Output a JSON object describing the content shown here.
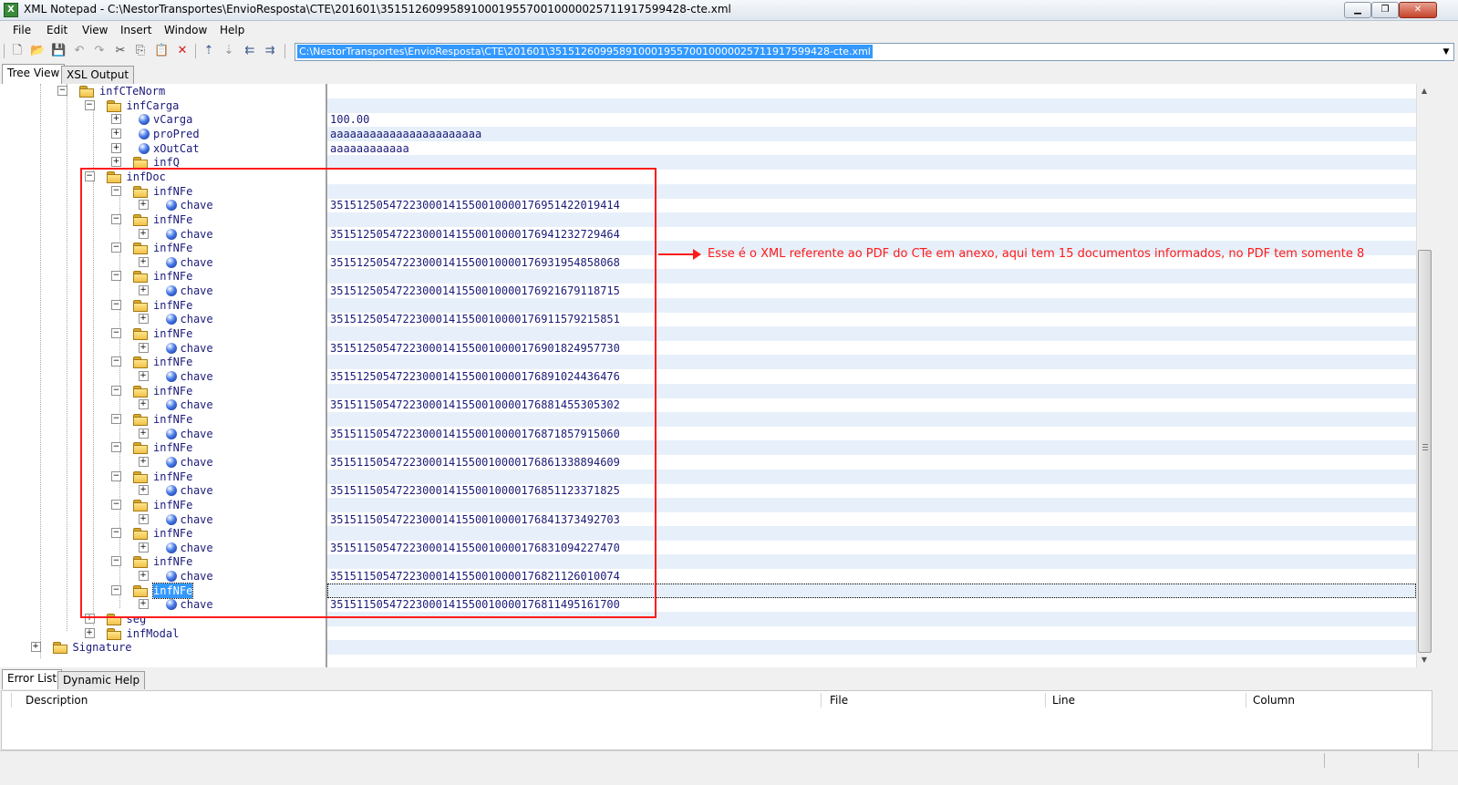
{
  "window": {
    "title": "XML Notepad - C:\\NestorTransportes\\EnvioResposta\\CTE\\201601\\35151260995891000195570010000025711917599428-cte.xml",
    "app_icon": "X"
  },
  "menu": [
    "File",
    "Edit",
    "View",
    "Insert",
    "Window",
    "Help"
  ],
  "toolbar": {
    "icons": [
      "new-icon",
      "open-icon",
      "save-icon",
      "undo-icon",
      "redo-icon",
      "cut-icon",
      "copy-icon",
      "paste-icon",
      "delete-icon",
      "nudge-up-icon",
      "nudge-down-icon",
      "nudge-left-icon",
      "nudge-right-icon"
    ],
    "path": "C:\\NestorTransportes\\EnvioResposta\\CTE\\201601\\35151260995891000195570010000025711917599428-cte.xml"
  },
  "tabs": [
    "Tree View",
    "XSL Output"
  ],
  "tree": [
    {
      "label": "infCTeNorm",
      "type": "element",
      "expander": "−"
    },
    {
      "label": "infCarga",
      "type": "element",
      "expander": "−"
    },
    {
      "label": "vCarga",
      "type": "attribute",
      "expander": "+",
      "value": "100.00"
    },
    {
      "label": "proPred",
      "type": "attribute",
      "expander": "+",
      "value": "aaaaaaaaaaaaaaaaaaaaaaa"
    },
    {
      "label": "xOutCat",
      "type": "attribute",
      "expander": "+",
      "value": "aaaaaaaaaaaa"
    },
    {
      "label": "infQ",
      "type": "element",
      "expander": "+"
    },
    {
      "label": "infDoc",
      "type": "element",
      "expander": "−"
    },
    {
      "label": "infNFe",
      "type": "element",
      "expander": "−"
    },
    {
      "label": "chave",
      "type": "attribute",
      "expander": "+",
      "value": "35151250547223000141550010000176951422019414"
    },
    {
      "label": "infNFe",
      "type": "element",
      "expander": "−"
    },
    {
      "label": "chave",
      "type": "attribute",
      "expander": "+",
      "value": "35151250547223000141550010000176941232729464"
    },
    {
      "label": "infNFe",
      "type": "element",
      "expander": "−"
    },
    {
      "label": "chave",
      "type": "attribute",
      "expander": "+",
      "value": "35151250547223000141550010000176931954858068"
    },
    {
      "label": "infNFe",
      "type": "element",
      "expander": "−"
    },
    {
      "label": "chave",
      "type": "attribute",
      "expander": "+",
      "value": "35151250547223000141550010000176921679118715"
    },
    {
      "label": "infNFe",
      "type": "element",
      "expander": "−"
    },
    {
      "label": "chave",
      "type": "attribute",
      "expander": "+",
      "value": "35151250547223000141550010000176911579215851"
    },
    {
      "label": "infNFe",
      "type": "element",
      "expander": "−"
    },
    {
      "label": "chave",
      "type": "attribute",
      "expander": "+",
      "value": "35151250547223000141550010000176901824957730"
    },
    {
      "label": "infNFe",
      "type": "element",
      "expander": "−"
    },
    {
      "label": "chave",
      "type": "attribute",
      "expander": "+",
      "value": "35151250547223000141550010000176891024436476"
    },
    {
      "label": "infNFe",
      "type": "element",
      "expander": "−"
    },
    {
      "label": "chave",
      "type": "attribute",
      "expander": "+",
      "value": "35151150547223000141550010000176881455305302"
    },
    {
      "label": "infNFe",
      "type": "element",
      "expander": "−"
    },
    {
      "label": "chave",
      "type": "attribute",
      "expander": "+",
      "value": "35151150547223000141550010000176871857915060"
    },
    {
      "label": "infNFe",
      "type": "element",
      "expander": "−"
    },
    {
      "label": "chave",
      "type": "attribute",
      "expander": "+",
      "value": "35151150547223000141550010000176861338894609"
    },
    {
      "label": "infNFe",
      "type": "element",
      "expander": "−"
    },
    {
      "label": "chave",
      "type": "attribute",
      "expander": "+",
      "value": "35151150547223000141550010000176851123371825"
    },
    {
      "label": "infNFe",
      "type": "element",
      "expander": "−"
    },
    {
      "label": "chave",
      "type": "attribute",
      "expander": "+",
      "value": "35151150547223000141550010000176841373492703"
    },
    {
      "label": "infNFe",
      "type": "element",
      "expander": "−"
    },
    {
      "label": "chave",
      "type": "attribute",
      "expander": "+",
      "value": "35151150547223000141550010000176831094227470"
    },
    {
      "label": "infNFe",
      "type": "element",
      "expander": "−"
    },
    {
      "label": "chave",
      "type": "attribute",
      "expander": "+",
      "value": "35151150547223000141550010000176821126010074"
    },
    {
      "label": "infNFe",
      "type": "element",
      "expander": "−",
      "selected": true
    },
    {
      "label": "chave",
      "type": "attribute",
      "expander": "+",
      "value": "35151150547223000141550010000176811495161700"
    },
    {
      "label": "seg",
      "type": "element",
      "expander": "+"
    },
    {
      "label": "infModal",
      "type": "element",
      "expander": "+"
    },
    {
      "label": "Signature",
      "type": "element",
      "expander": "+"
    }
  ],
  "annotation": {
    "text": "Esse é o XML referente ao PDF do CTe em anexo, aqui tem 15 documentos informados, no PDF tem somente 8",
    "color": "#ff1a1a"
  },
  "bottom_tabs": [
    "Error List",
    "Dynamic Help"
  ],
  "error_list": {
    "columns": [
      "Description",
      "File",
      "Line",
      "Column"
    ]
  },
  "colors": {
    "selection": "#3399ff",
    "alt_row": "#e7f0fa",
    "node_text": "#1a1a7a"
  }
}
